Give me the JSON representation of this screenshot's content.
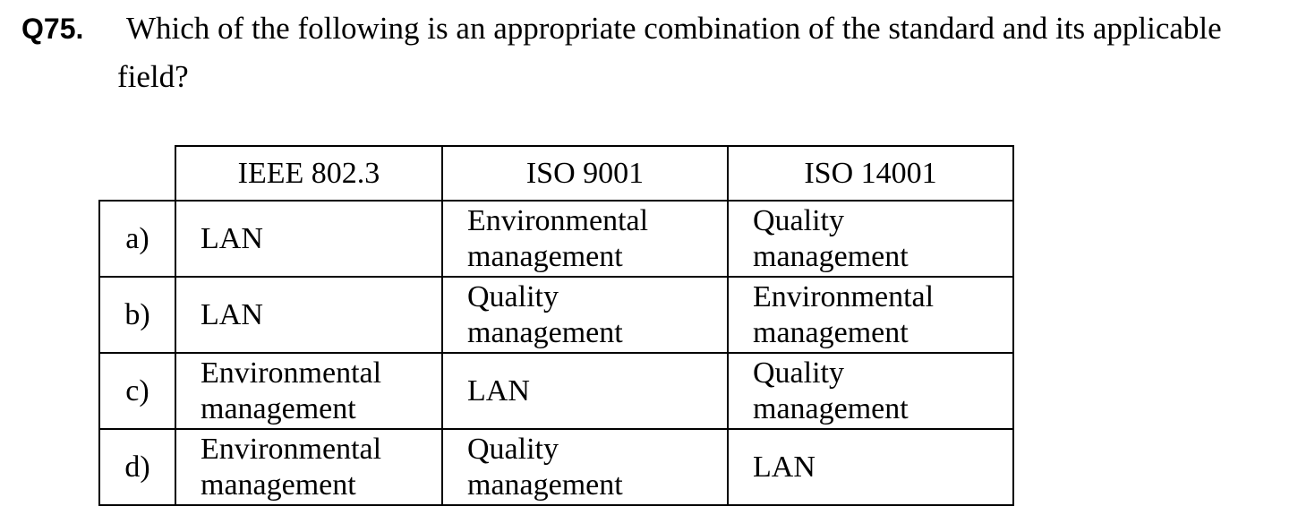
{
  "question": {
    "number": "Q75.",
    "text_line_1": "Which of the following is an appropriate combination of the standard and its applicable",
    "text_line_2": "field?"
  },
  "table": {
    "headers": [
      "IEEE 802.3",
      "ISO 9001",
      "ISO 14001"
    ],
    "options": [
      {
        "label": "a)",
        "cells": [
          "LAN",
          "Environmental\nmanagement",
          "Quality\nmanagement"
        ]
      },
      {
        "label": "b)",
        "cells": [
          "LAN",
          "Quality\nmanagement",
          "Environmental\nmanagement"
        ]
      },
      {
        "label": "c)",
        "cells": [
          "Environmental\nmanagement",
          "LAN",
          "Quality\nmanagement"
        ]
      },
      {
        "label": "d)",
        "cells": [
          "Environmental\nmanagement",
          "Quality\nmanagement",
          "LAN"
        ]
      }
    ]
  }
}
